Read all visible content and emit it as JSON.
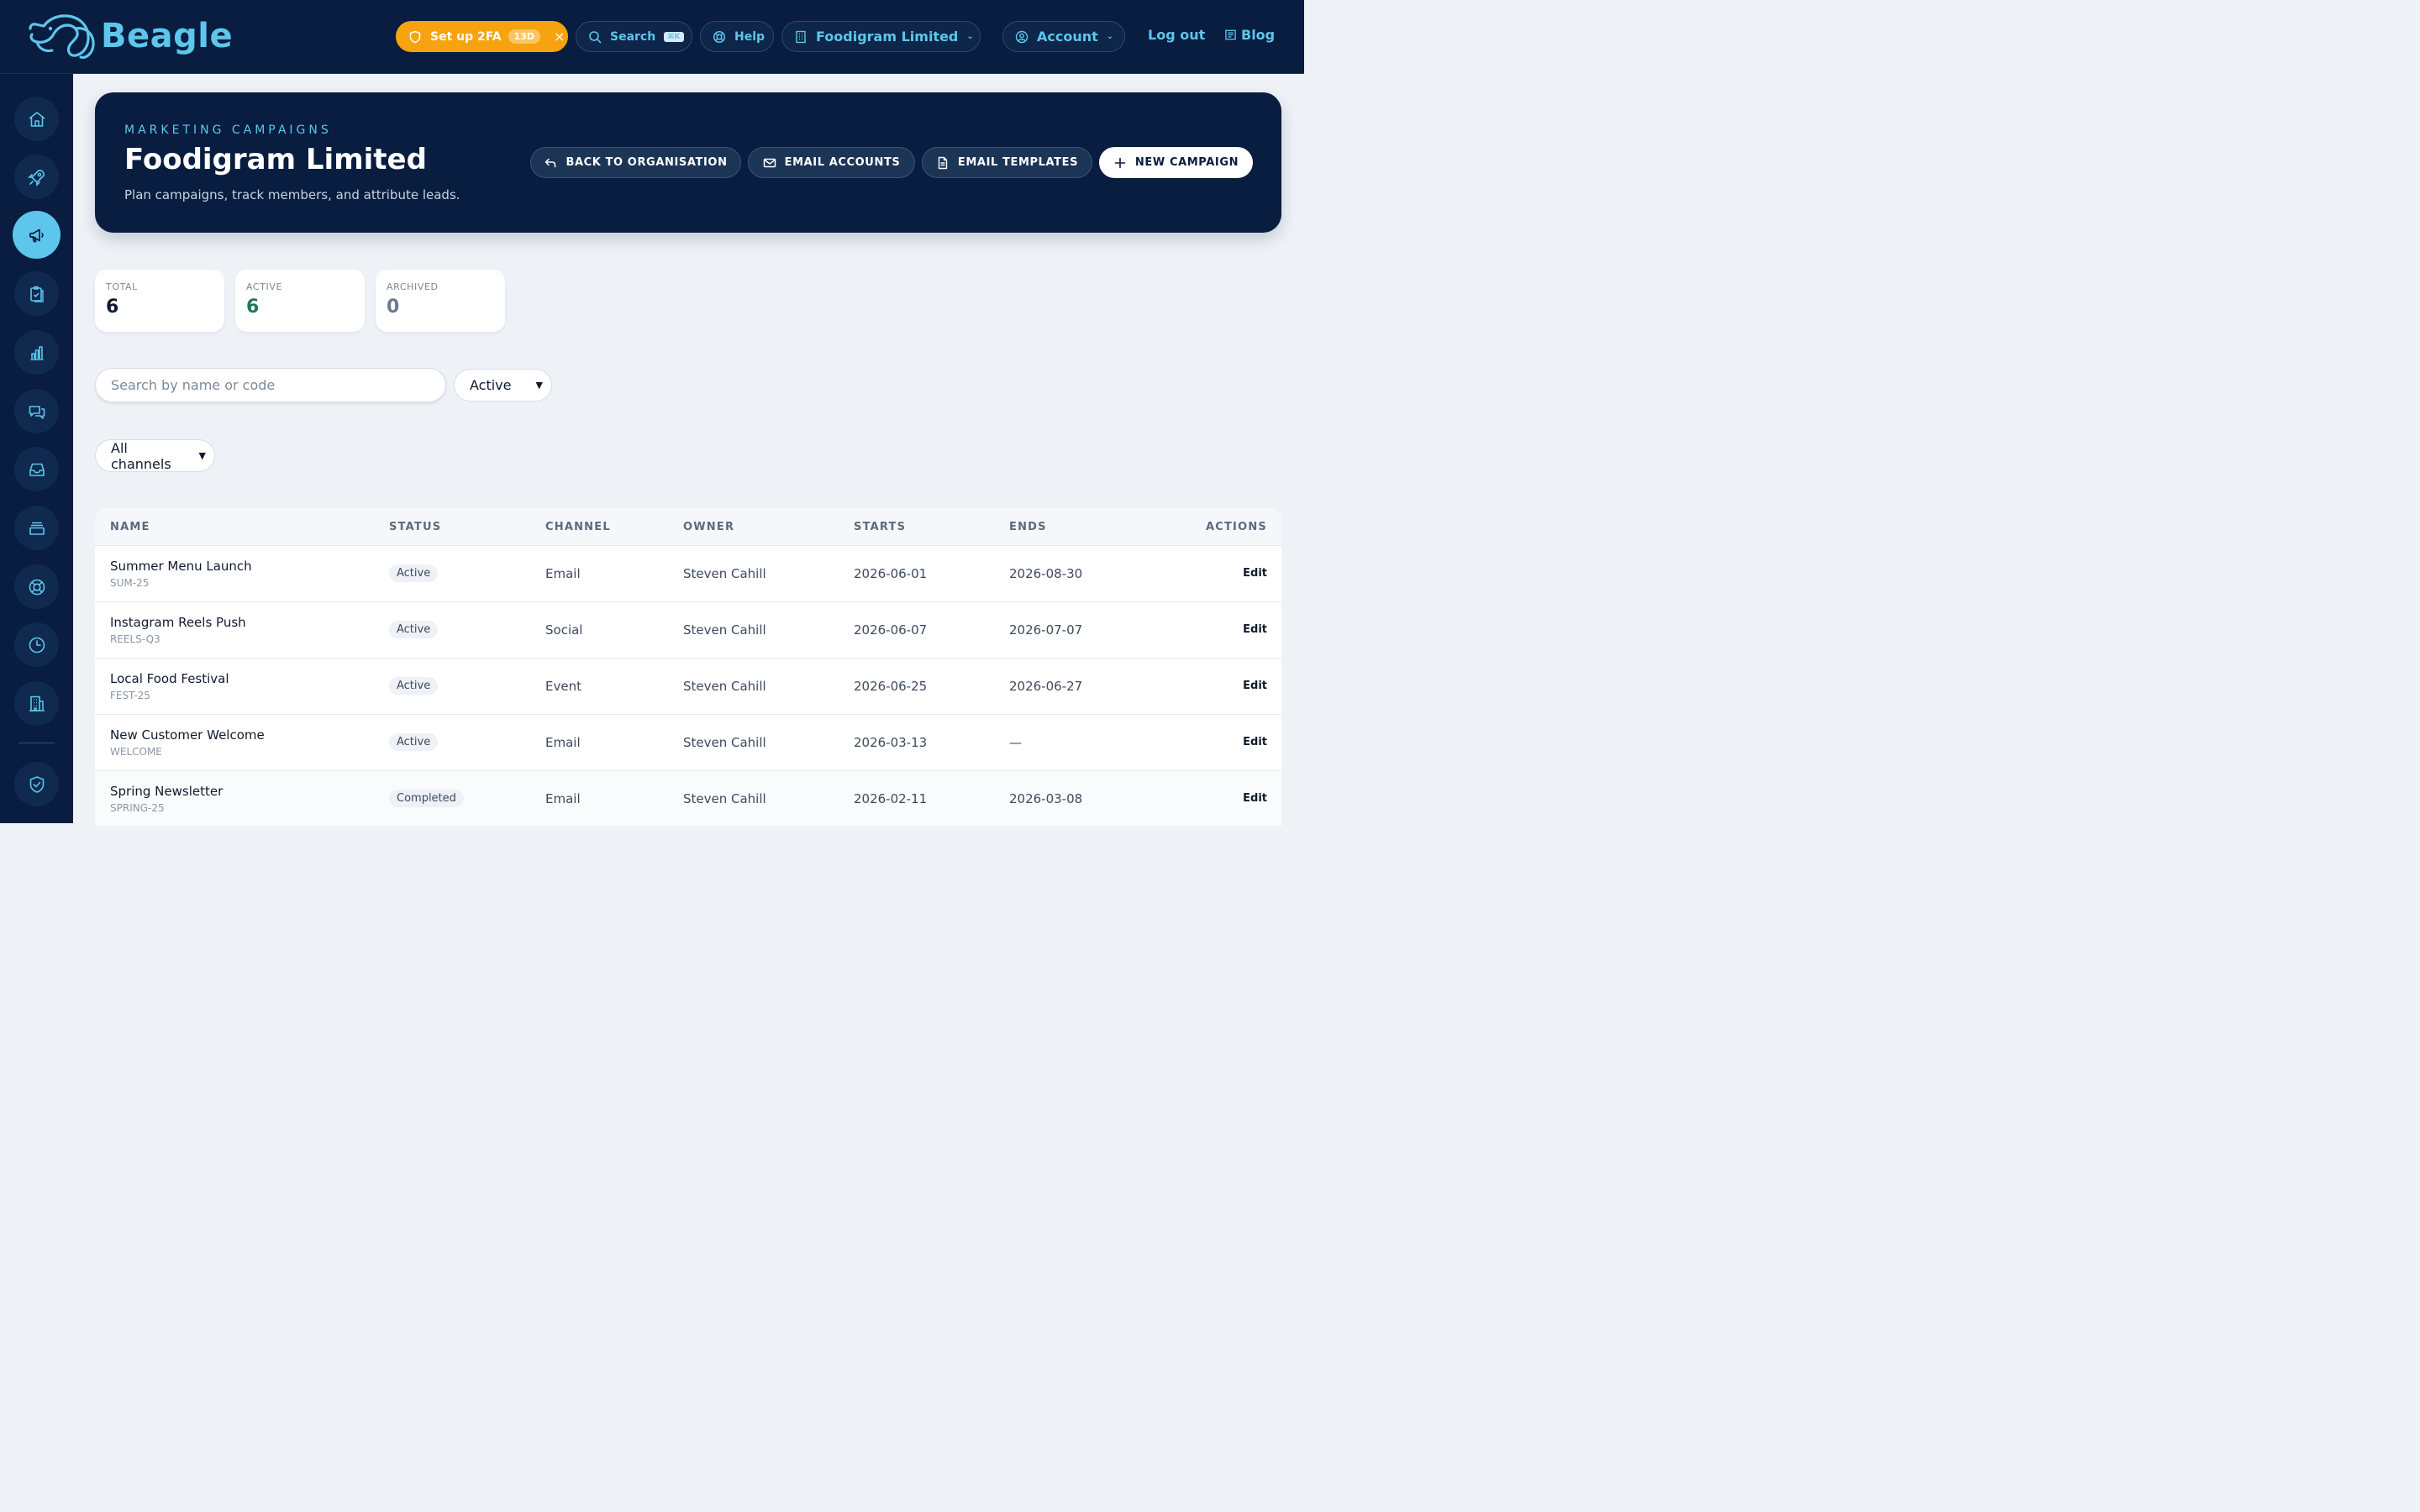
{
  "brand": {
    "name": "Beagle"
  },
  "topbar": {
    "twofa": {
      "label": "Set up 2FA",
      "badge": "13D",
      "close": "×"
    },
    "search": {
      "label": "Search",
      "shortcut": "⌘K"
    },
    "help": {
      "label": "Help"
    },
    "org": {
      "label": "Foodigram Limited"
    },
    "account": {
      "label": "Account"
    },
    "logout": "Log out",
    "blog": "Blog"
  },
  "sidebar": {
    "items": [
      {
        "icon": "home-icon"
      },
      {
        "icon": "rocket-icon"
      },
      {
        "icon": "megaphone-icon",
        "active": true
      },
      {
        "icon": "clipboard-icon"
      },
      {
        "icon": "bar-chart-icon"
      },
      {
        "icon": "chat-icon"
      },
      {
        "icon": "inbox-icon"
      },
      {
        "icon": "archive-icon"
      },
      {
        "icon": "lifebuoy-icon"
      },
      {
        "icon": "clock-icon"
      },
      {
        "icon": "building-icon"
      },
      {
        "icon": "shield-icon"
      }
    ]
  },
  "hero": {
    "eyebrow": "MARKETING CAMPAIGNS",
    "title": "Foodigram Limited",
    "subtitle": "Plan campaigns, track members, and attribute leads.",
    "buttons": {
      "back": "BACK TO ORGANISATION",
      "accounts": "EMAIL ACCOUNTS",
      "templates": "EMAIL TEMPLATES",
      "new": "NEW CAMPAIGN"
    }
  },
  "stats": {
    "total": {
      "label": "TOTAL",
      "value": "6"
    },
    "active": {
      "label": "ACTIVE",
      "value": "6"
    },
    "archived": {
      "label": "ARCHIVED",
      "value": "0"
    }
  },
  "filters": {
    "search_placeholder": "Search by name or code",
    "status": "Active",
    "channel": "All channels"
  },
  "table": {
    "headers": [
      "NAME",
      "STATUS",
      "CHANNEL",
      "OWNER",
      "STARTS",
      "ENDS",
      "ACTIONS"
    ],
    "rows": [
      {
        "name": "Summer Menu Launch",
        "code": "SUM-25",
        "status": "Active",
        "channel": "Email",
        "owner": "Steven Cahill",
        "starts": "2026-06-01",
        "ends": "2026-08-30",
        "action": "Edit"
      },
      {
        "name": "Instagram Reels Push",
        "code": "REELS-Q3",
        "status": "Active",
        "channel": "Social",
        "owner": "Steven Cahill",
        "starts": "2026-06-07",
        "ends": "2026-07-07",
        "action": "Edit"
      },
      {
        "name": "Local Food Festival",
        "code": "FEST-25",
        "status": "Active",
        "channel": "Event",
        "owner": "Steven Cahill",
        "starts": "2026-06-25",
        "ends": "2026-06-27",
        "action": "Edit"
      },
      {
        "name": "New Customer Welcome",
        "code": "WELCOME",
        "status": "Active",
        "channel": "Email",
        "owner": "Steven Cahill",
        "starts": "2026-03-13",
        "ends": "—",
        "action": "Edit"
      },
      {
        "name": "Spring Newsletter",
        "code": "SPRING-25",
        "status": "Completed",
        "channel": "Email",
        "owner": "Steven Cahill",
        "starts": "2026-02-11",
        "ends": "2026-03-08",
        "action": "Edit"
      }
    ]
  },
  "colors": {
    "navy": "#081d3f",
    "accent": "#5ec6ec",
    "warning": "#f7a30f",
    "active_green": "#1f7a55",
    "archived_grey": "#6b7a90"
  }
}
